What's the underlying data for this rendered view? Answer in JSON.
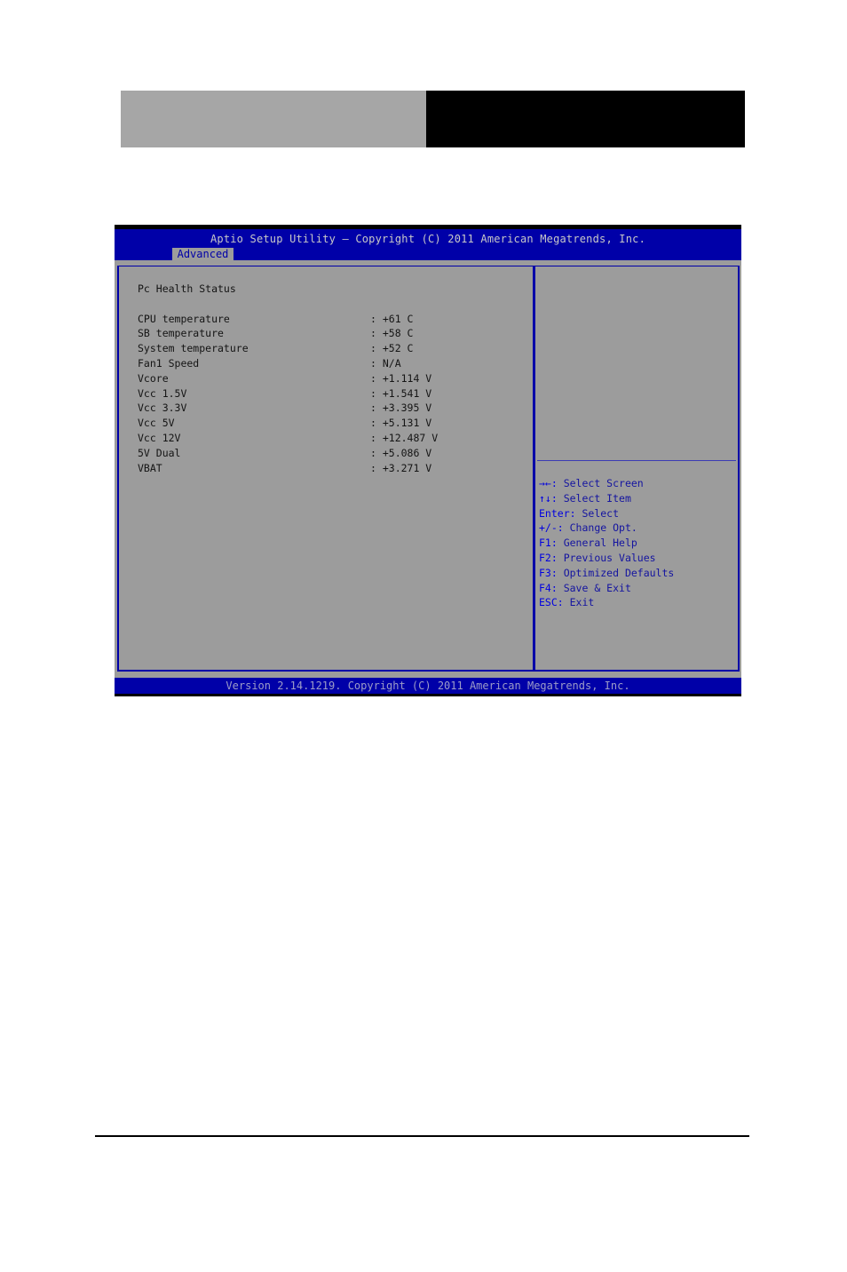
{
  "document": {
    "banner": {
      "left_color": "#a6a6a6",
      "right_color": "#000000"
    }
  },
  "bios": {
    "title": "Aptio Setup Utility – Copyright (C) 2011 American Megatrends, Inc.",
    "tabs": [
      {
        "label": "Advanced",
        "active": true
      }
    ],
    "section_title": "Pc Health Status",
    "items": [
      {
        "label": "CPU temperature",
        "value": ": +61 C"
      },
      {
        "label": "SB temperature",
        "value": ": +58 C"
      },
      {
        "label": "System temperature",
        "value": ": +52 C"
      },
      {
        "label": "Fan1 Speed",
        "value": ": N/A"
      },
      {
        "label": "Vcore",
        "value": ": +1.114 V"
      },
      {
        "label": "Vcc 1.5V",
        "value": ": +1.541 V"
      },
      {
        "label": "Vcc 3.3V",
        "value": ": +3.395 V"
      },
      {
        "label": "Vcc 5V",
        "value": ": +5.131 V"
      },
      {
        "label": "Vcc 12V",
        "value": ": +12.487 V"
      },
      {
        "label": "5V Dual",
        "value": ": +5.086 V"
      },
      {
        "label": "VBAT",
        "value": ": +3.271 V"
      }
    ],
    "help": [
      {
        "key": "→←:",
        "desc": " Select Screen"
      },
      {
        "key": "↑↓:",
        "desc": " Select Item"
      },
      {
        "key": "Enter:",
        "desc": " Select"
      },
      {
        "key": "+/-:",
        "desc": " Change Opt."
      },
      {
        "key": "F1:",
        "desc": " General Help"
      },
      {
        "key": "F2:",
        "desc": " Previous Values"
      },
      {
        "key": "F3:",
        "desc": " Optimized Defaults"
      },
      {
        "key": "F4:",
        "desc": " Save & Exit"
      },
      {
        "key": "ESC:",
        "desc": " Exit"
      }
    ],
    "footer": "Version 2.14.1219. Copyright (C) 2011 American Megatrends, Inc.",
    "colors": {
      "header_bg": "#0000a8",
      "body_bg": "#9c9c9c",
      "tab_bg": "#9c9c9c",
      "help_key": "#0000e0",
      "help_desc": "#1414a0"
    }
  }
}
